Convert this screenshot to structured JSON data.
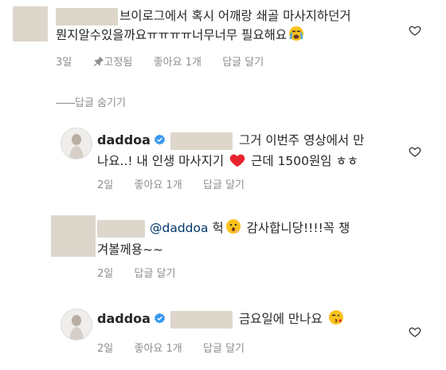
{
  "comments": {
    "c1": {
      "text_line1": "브이로그에서 혹시 어깨랑 쇄골 마사지하던거",
      "text_line2": "뭔지알수있을까요ㅠㅠㅠㅠ너무너무 필요해요",
      "age": "3일",
      "pinned": "고정됨",
      "likes": "좋아요 1개",
      "reply": "답글 달기"
    },
    "hide_replies": "답글 숨기기",
    "r1": {
      "username": "daddoa",
      "text_part1": "그거 이번주 영상에서 만",
      "text_part2": "나요..! 내 인생 마사지기",
      "text_part3": "근데 1500원임 ㅎㅎ",
      "age": "2일",
      "likes": "좋아요 1개",
      "reply": "답글 달기"
    },
    "r2": {
      "mention": "@daddoa",
      "text_part1": "헉",
      "text_part2": "감사합니당!!!!꼭 챙",
      "text_line2": "겨볼께용~~",
      "age": "2일",
      "reply": "답글 달기"
    },
    "r3": {
      "username": "daddoa",
      "text": "금요일에 만나요",
      "age": "2일",
      "likes": "좋아요 1개",
      "reply": "답글 달기"
    }
  }
}
